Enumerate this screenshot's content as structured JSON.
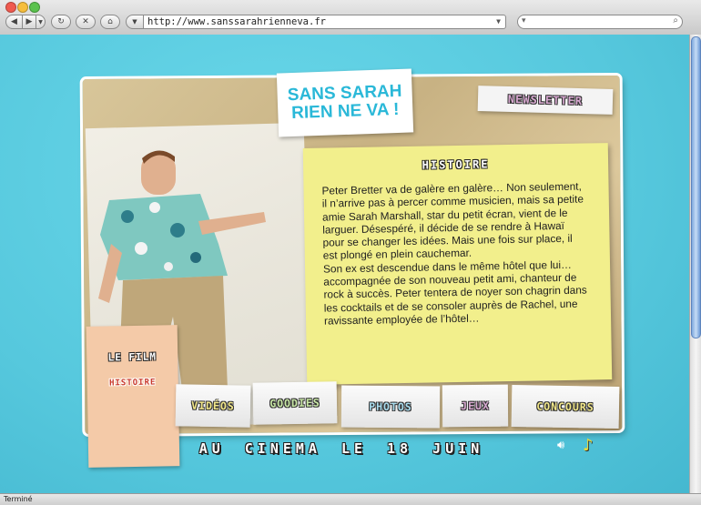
{
  "browser": {
    "url": "http://www.sanssarahrienneva.fr",
    "status": "Terminé"
  },
  "site": {
    "logo_line1": "SANS SARAH",
    "logo_line2": "RIEN NE VA !",
    "newsletter_label": "NEWSLETTER",
    "film_label": "LE FILM",
    "histoire_link": "HISTOIRE",
    "panel_title": "HISTOIRE",
    "story_paragraph1": "Peter Bretter va de galère en galère… Non seulement, il n’arrive pas à percer comme musicien, mais sa petite amie Sarah Marshall, star du petit écran, vient de le larguer. Désespéré, il décide de se rendre à Hawaï pour se changer les idées. Mais une fois sur place, il est plongé en plein cauchemar.",
    "story_paragraph2": "Son ex est descendue dans le même hôtel que lui… accompagnée de son nouveau petit ami, chanteur de rock à succès. Peter tentera de noyer son chagrin dans les cocktails et de se consoler auprès de Rachel, une ravissante employée de l’hôtel…",
    "nav": {
      "videos": "VIDÉOS",
      "goodies": "GOODIES",
      "photos": "PHOTOS",
      "jeux": "JEUX",
      "concours": "CONCOURS"
    },
    "tagline": "AU CINEMA LE 18 JUIN",
    "colors": {
      "background": "#5fd0e3",
      "logo_text": "#2ab8d8",
      "panel": "#f2ef8c",
      "film_panel": "#f4caa8",
      "accent_red": "#c8372a"
    }
  }
}
